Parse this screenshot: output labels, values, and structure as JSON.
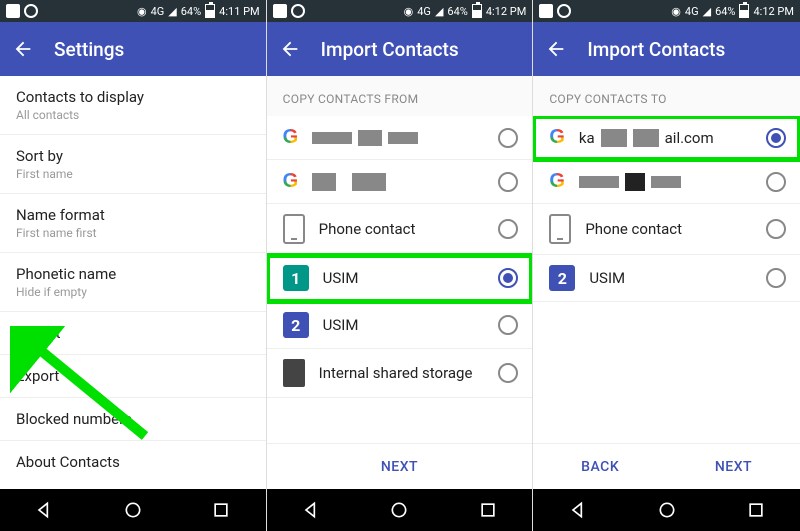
{
  "status": {
    "network": "4G",
    "battery": "64%",
    "time1": "4:11 PM",
    "time2": "4:12 PM",
    "time3": "4:12 PM"
  },
  "screen1": {
    "title": "Settings",
    "items": [
      {
        "primary": "Contacts to display",
        "secondary": "All contacts"
      },
      {
        "primary": "Sort by",
        "secondary": "First name"
      },
      {
        "primary": "Name format",
        "secondary": "First name first"
      },
      {
        "primary": "Phonetic name",
        "secondary": "Hide if empty"
      },
      {
        "primary": "Import",
        "secondary": ""
      },
      {
        "primary": "Export",
        "secondary": ""
      },
      {
        "primary": "Blocked numbers",
        "secondary": ""
      },
      {
        "primary": "About Contacts",
        "secondary": ""
      }
    ]
  },
  "screen2": {
    "title": "Import Contacts",
    "subheader": "COPY CONTACTS FROM",
    "sources": [
      {
        "icon": "google",
        "label": "",
        "redacted": true,
        "selected": false
      },
      {
        "icon": "google",
        "label": "",
        "redacted": true,
        "selected": false
      },
      {
        "icon": "phone",
        "label": "Phone contact",
        "selected": false
      },
      {
        "icon": "sim",
        "simColor": "#009688",
        "simNum": "1",
        "label": "USIM",
        "selected": true,
        "highlight": true
      },
      {
        "icon": "sim",
        "simColor": "#3f51b5",
        "simNum": "2",
        "label": "USIM",
        "selected": false
      },
      {
        "icon": "storage",
        "label": "Internal shared storage",
        "selected": false
      }
    ],
    "next": "NEXT"
  },
  "screen3": {
    "title": "Import Contacts",
    "subheader": "COPY CONTACTS TO",
    "targets": [
      {
        "icon": "google",
        "label_parts": [
          "ka",
          "ail.com"
        ],
        "redacted": true,
        "selected": true,
        "highlight": true
      },
      {
        "icon": "google",
        "label": "",
        "redacted": true,
        "selected": false
      },
      {
        "icon": "phone",
        "label": "Phone contact",
        "selected": false
      },
      {
        "icon": "sim",
        "simColor": "#3f51b5",
        "simNum": "2",
        "label": "USIM",
        "selected": false
      }
    ],
    "back": "BACK",
    "next": "NEXT"
  },
  "nav": {
    "back": "◁",
    "home": "○",
    "recent": "□"
  }
}
